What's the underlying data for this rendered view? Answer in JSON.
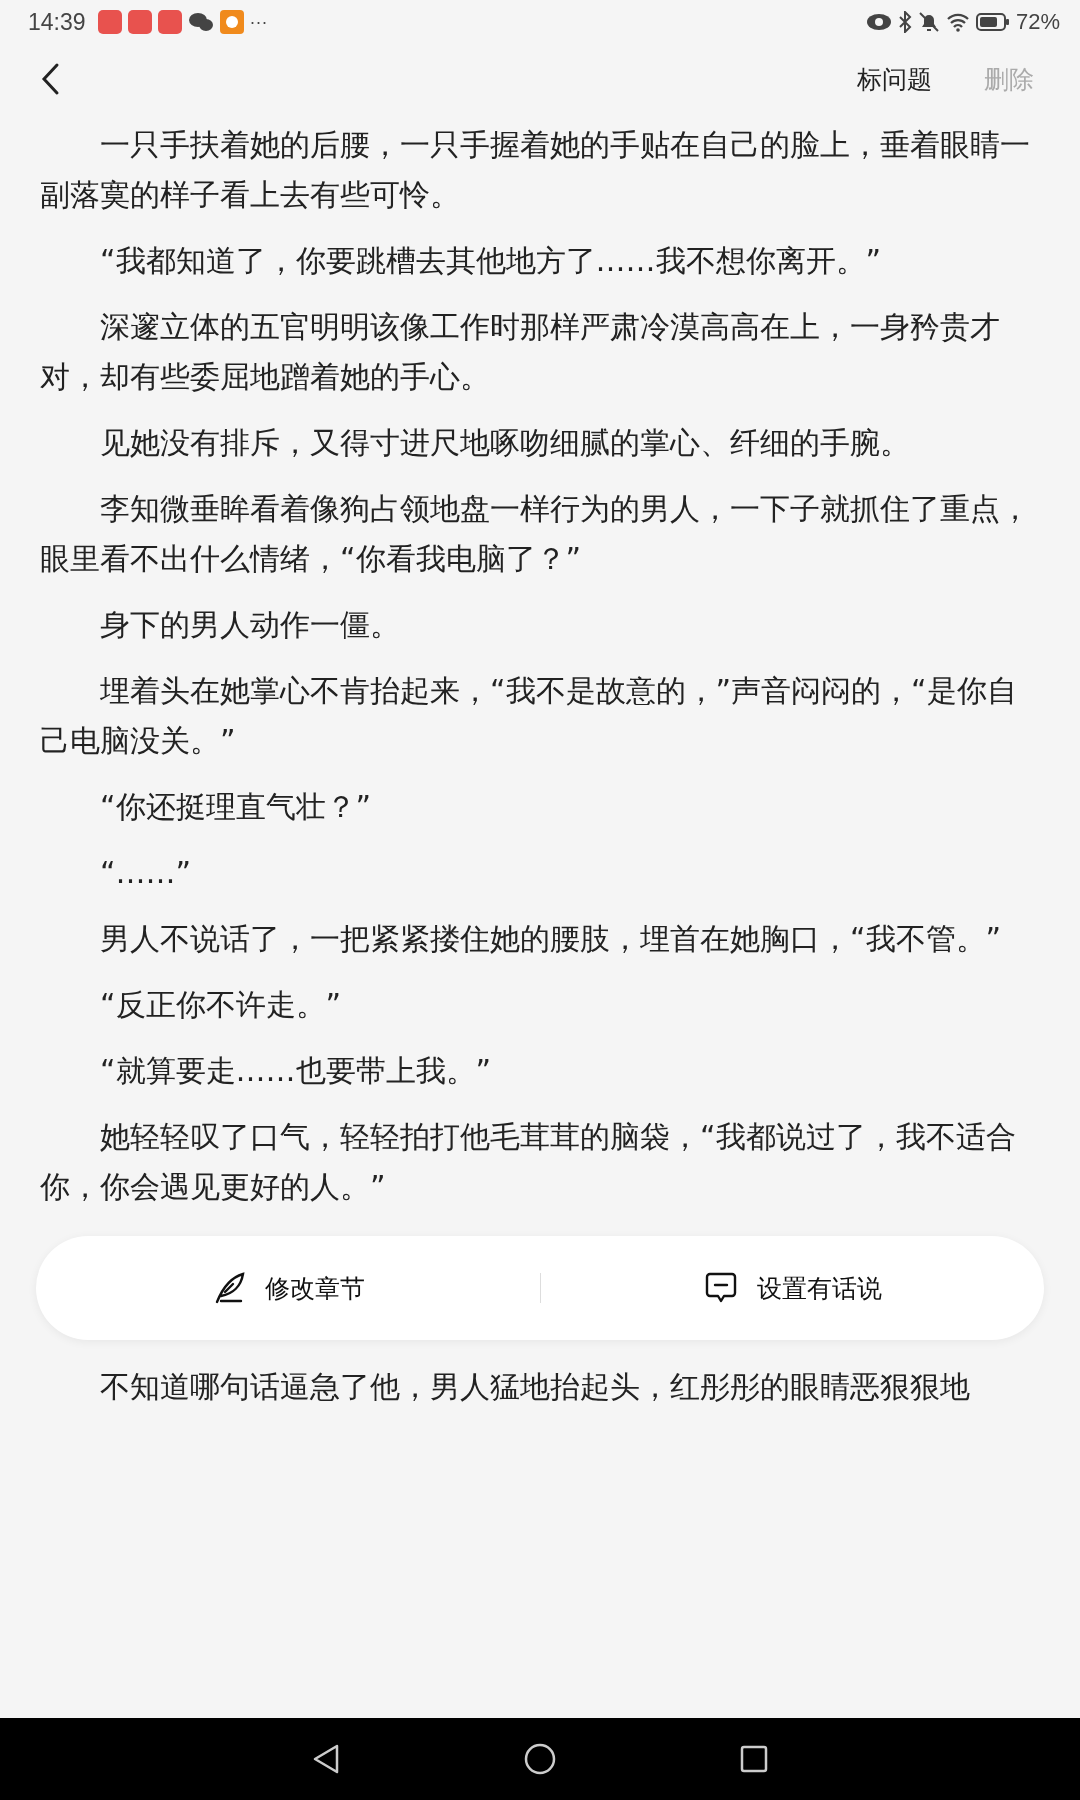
{
  "status_bar": {
    "time": "14:39",
    "more": "···",
    "battery_level_text": "72%"
  },
  "header": {
    "actions": [
      {
        "label": "标问题",
        "disabled": false
      },
      {
        "label": "删除",
        "disabled": true
      }
    ]
  },
  "paragraphs": [
    "一只手扶着她的后腰，一只手握着她的手贴在自己的脸上，垂着眼睛一副落寞的样子看上去有些可怜。",
    "“我都知道了，你要跳槽去其他地方了……我不想你离开。”",
    "深邃立体的五官明明该像工作时那样严肃冷漠高高在上，一身矜贵才对，却有些委屈地蹭着她的手心。",
    "见她没有排斥，又得寸进尺地啄吻细腻的掌心、纤细的手腕。",
    "李知微垂眸看着像狗占领地盘一样行为的男人，一下子就抓住了重点，眼里看不出什么情绪，“你看我电脑了？”",
    "身下的男人动作一僵。",
    "埋着头在她掌心不肯抬起来，“我不是故意的，”声音闷闷的，“是你自己电脑没关。”",
    "“你还挺理直气壮？”",
    "“……”",
    "男人不说话了，一把紧紧搂住她的腰肢，埋首在她胸口，“我不管。”",
    "“反正你不许走。”",
    "“就算要走……也要带上我。”",
    "她轻轻叹了口气，轻轻拍打他毛茸茸的脑袋，“我都说过了，我不适合你，你会遇见更好的人。”"
  ],
  "action_bar": [
    {
      "kind": "edit",
      "label": "修改章节"
    },
    {
      "kind": "comment",
      "label": "设置有话说"
    }
  ],
  "after_bar_paragraph": "不知道哪句话逼急了他，男人猛地抬起头，红彤彤的眼睛恶狠狠地"
}
